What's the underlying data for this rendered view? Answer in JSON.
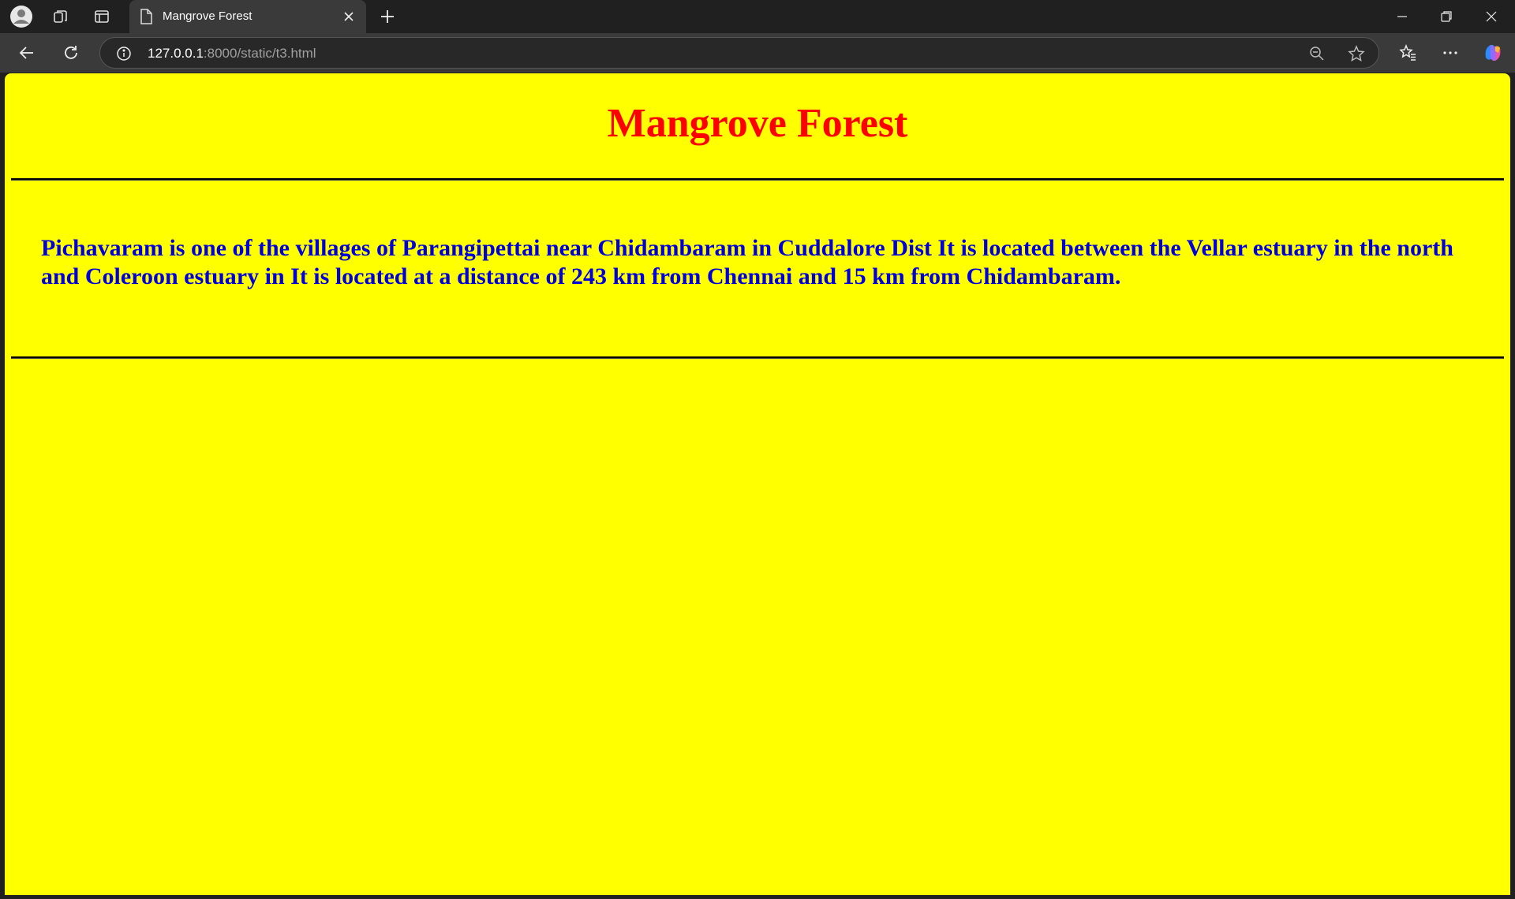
{
  "browser": {
    "tab": {
      "title": "Mangrove Forest"
    },
    "address_bar": {
      "host": "127.0.0.1",
      "path": ":8000/static/t3.html"
    },
    "icons": [
      "profile-icon",
      "workspaces-icon",
      "sidebar-icon",
      "page-icon",
      "close-icon",
      "plus-icon",
      "minimize-icon",
      "restore-icon",
      "close-window-icon",
      "back-icon",
      "refresh-icon",
      "info-icon",
      "zoom-out-icon",
      "star-icon",
      "favorites-icon",
      "more-icon",
      "copilot-icon"
    ]
  },
  "page": {
    "background": "#ffff00",
    "title": "Mangrove Forest",
    "title_color": "#ff0000",
    "paragraph": "Pichavaram is one of the villages of Parangipettai near Chidambaram in Cuddalore Dist It is located between the Vellar estuary in the north and Coleroon estuary in It is located at a distance of 243 km from Chennai and 15 km from Chidambaram.",
    "paragraph_color": "#0000dd"
  }
}
